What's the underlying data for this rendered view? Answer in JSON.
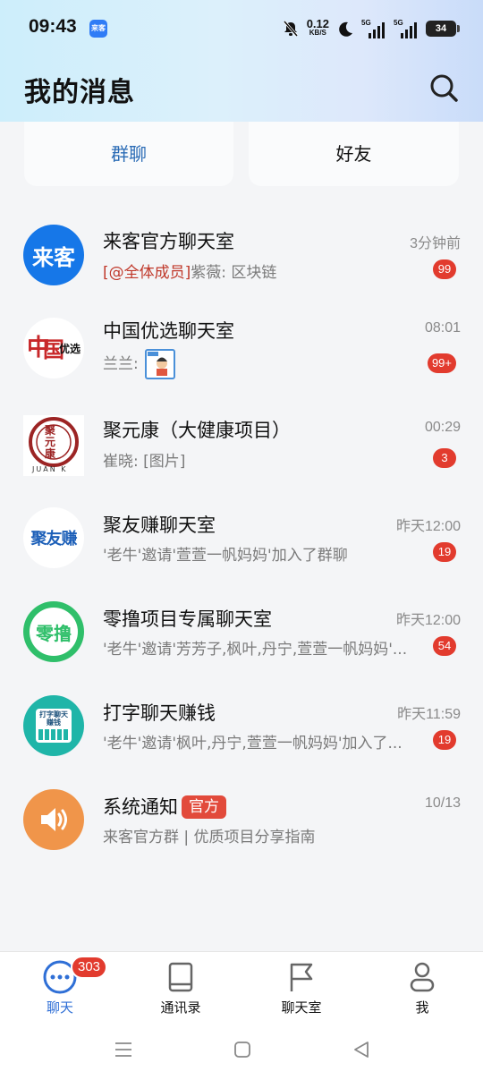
{
  "status_bar": {
    "time": "09:43",
    "app_icon_text": "来客",
    "speed_value": "0.12",
    "speed_unit": "KB/S",
    "network1": "5G",
    "network2": "5G",
    "battery": "34"
  },
  "header": {
    "title": "我的消息"
  },
  "tabs": {
    "group_chat": "群聊",
    "friends": "好友"
  },
  "chats": [
    {
      "name": "来客官方聊天室",
      "time": "3分钟前",
      "mention": "[@全体成员]",
      "preview": "紫薇: 区块链",
      "badge": "99",
      "avatar_text": "来客",
      "avatar_color": "#1677e8"
    },
    {
      "name": "中国优选聊天室",
      "time": "08:01",
      "preview": "兰兰:",
      "badge": "99+",
      "avatar_text": "优选"
    },
    {
      "name": "聚元康（大健康项目）",
      "time": "00:29",
      "preview": "崔晓: [图片]",
      "badge": "3",
      "avatar_text": "聚元康",
      "avatar_sub": "JUAN K"
    },
    {
      "name": "聚友赚聊天室",
      "time": "昨天12:00",
      "preview": "'老牛'邀请'萱萱一帆妈妈'加入了群聊",
      "badge": "19",
      "avatar_text": "聚友赚"
    },
    {
      "name": "零撸项目专属聊天室",
      "time": "昨天12:00",
      "preview": "'老牛'邀请'芳芳子,枫叶,丹宁,萱萱一帆妈妈'...",
      "badge": "54",
      "avatar_text": "零撸",
      "avatar_color": "#2fbf6a"
    },
    {
      "name": "打字聊天赚钱",
      "time": "昨天11:59",
      "preview": "'老牛'邀请'枫叶,丹宁,萱萱一帆妈妈'加入了...",
      "badge": "19",
      "avatar_text": "打字聊天赚钱",
      "avatar_color": "#1fb5a8"
    },
    {
      "name": "系统通知",
      "tag": "官方",
      "time": "10/13",
      "preview": "来客官方群 | 优质项目分享指南",
      "avatar_color": "#f0954a"
    }
  ],
  "bottom_nav": {
    "chat": "聊天",
    "chat_badge": "303",
    "contacts": "通讯录",
    "rooms": "聊天室",
    "me": "我"
  },
  "colors": {
    "accent": "#2f6fd6",
    "badge": "#e23b2e",
    "tab_active": "#2a6bb5"
  }
}
